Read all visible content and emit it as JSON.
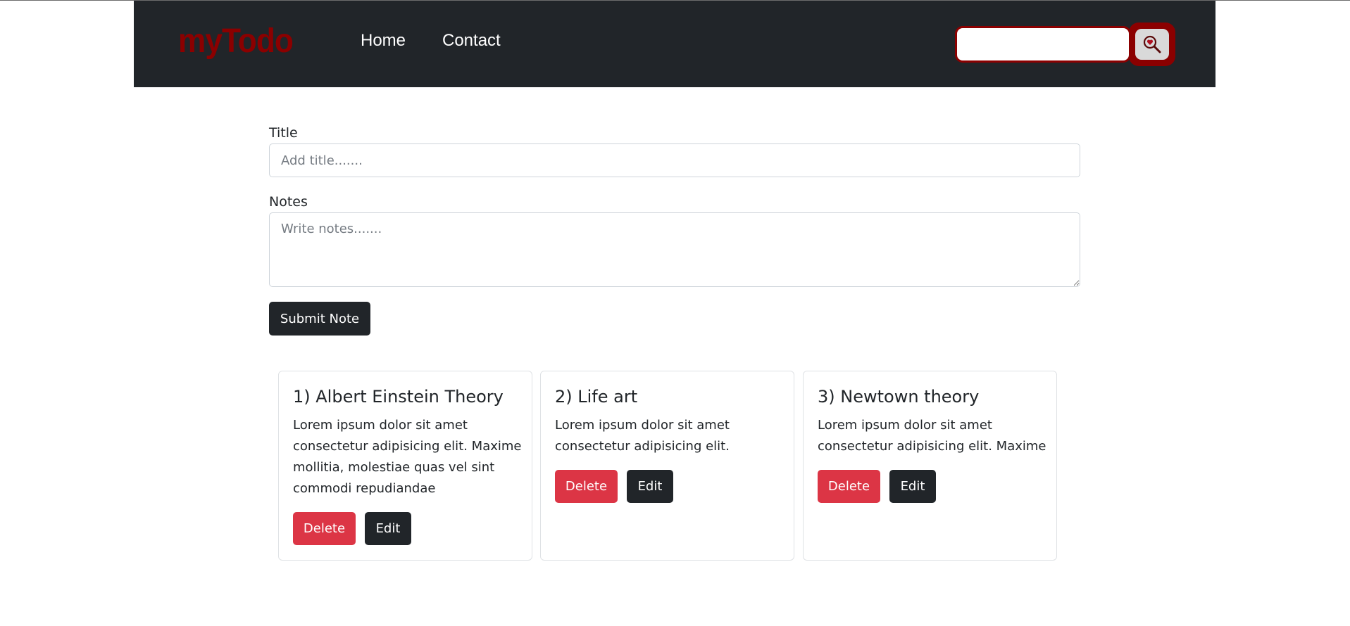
{
  "navbar": {
    "brand": "myTodo",
    "links": [
      "Home",
      "Contact"
    ],
    "search": {
      "value": "",
      "placeholder": "",
      "button_icon": "heart-search-icon"
    }
  },
  "form": {
    "title_label": "Title",
    "title_placeholder": "Add title.......",
    "notes_label": "Notes",
    "notes_placeholder": "Write notes.......",
    "submit_label": "Submit Note"
  },
  "notes": [
    {
      "title": "1) Albert Einstein Theory",
      "body": "Lorem ipsum dolor sit amet consectetur adipisicing elit. Maxime mollitia, molestiae quas vel sint commodi repudiandae",
      "delete_label": "Delete",
      "edit_label": "Edit"
    },
    {
      "title": "2) Life art",
      "body": "Lorem ipsum dolor sit amet consectetur adipisicing elit.",
      "delete_label": "Delete",
      "edit_label": "Edit"
    },
    {
      "title": "3) Newtown theory",
      "body": "Lorem ipsum dolor sit amet consectetur adipisicing elit. Maxime",
      "delete_label": "Delete",
      "edit_label": "Edit"
    }
  ],
  "colors": {
    "navbar_bg": "#212529",
    "brand": "#8b0000",
    "search_accent": "#8b0000",
    "danger": "#dc3545",
    "dark": "#212529"
  }
}
